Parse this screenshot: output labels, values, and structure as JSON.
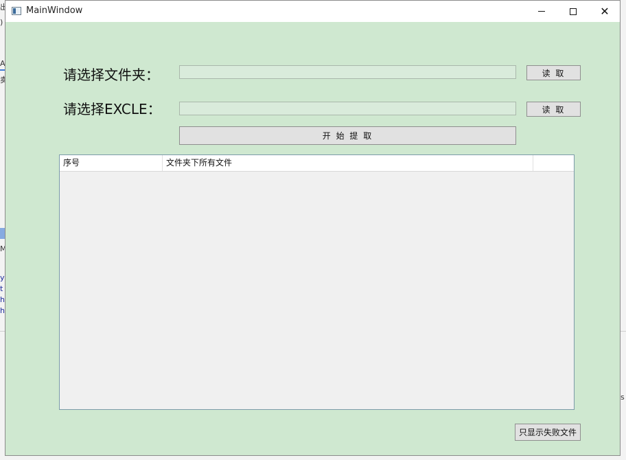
{
  "window": {
    "title": "MainWindow",
    "icon": "app-window-icon",
    "controls": [
      "minimize-icon",
      "maximize-icon",
      "close-icon"
    ],
    "close_glyph": "✕"
  },
  "form": {
    "folder_label": "请选择文件夹：",
    "folder_value": "",
    "folder_button": "读 取",
    "excel_label": "请选择EXCLE：",
    "excel_value": "",
    "excel_button": "读 取",
    "start_button": "开 始 提 取"
  },
  "table": {
    "columns": [
      "序号",
      "文件夹下所有文件",
      ""
    ],
    "rows": []
  },
  "footer": {
    "filter_button": "只显示失败文件"
  },
  "colors": {
    "window_bg": "#cfe8d0",
    "titlebar_bg": "#ffffff"
  }
}
